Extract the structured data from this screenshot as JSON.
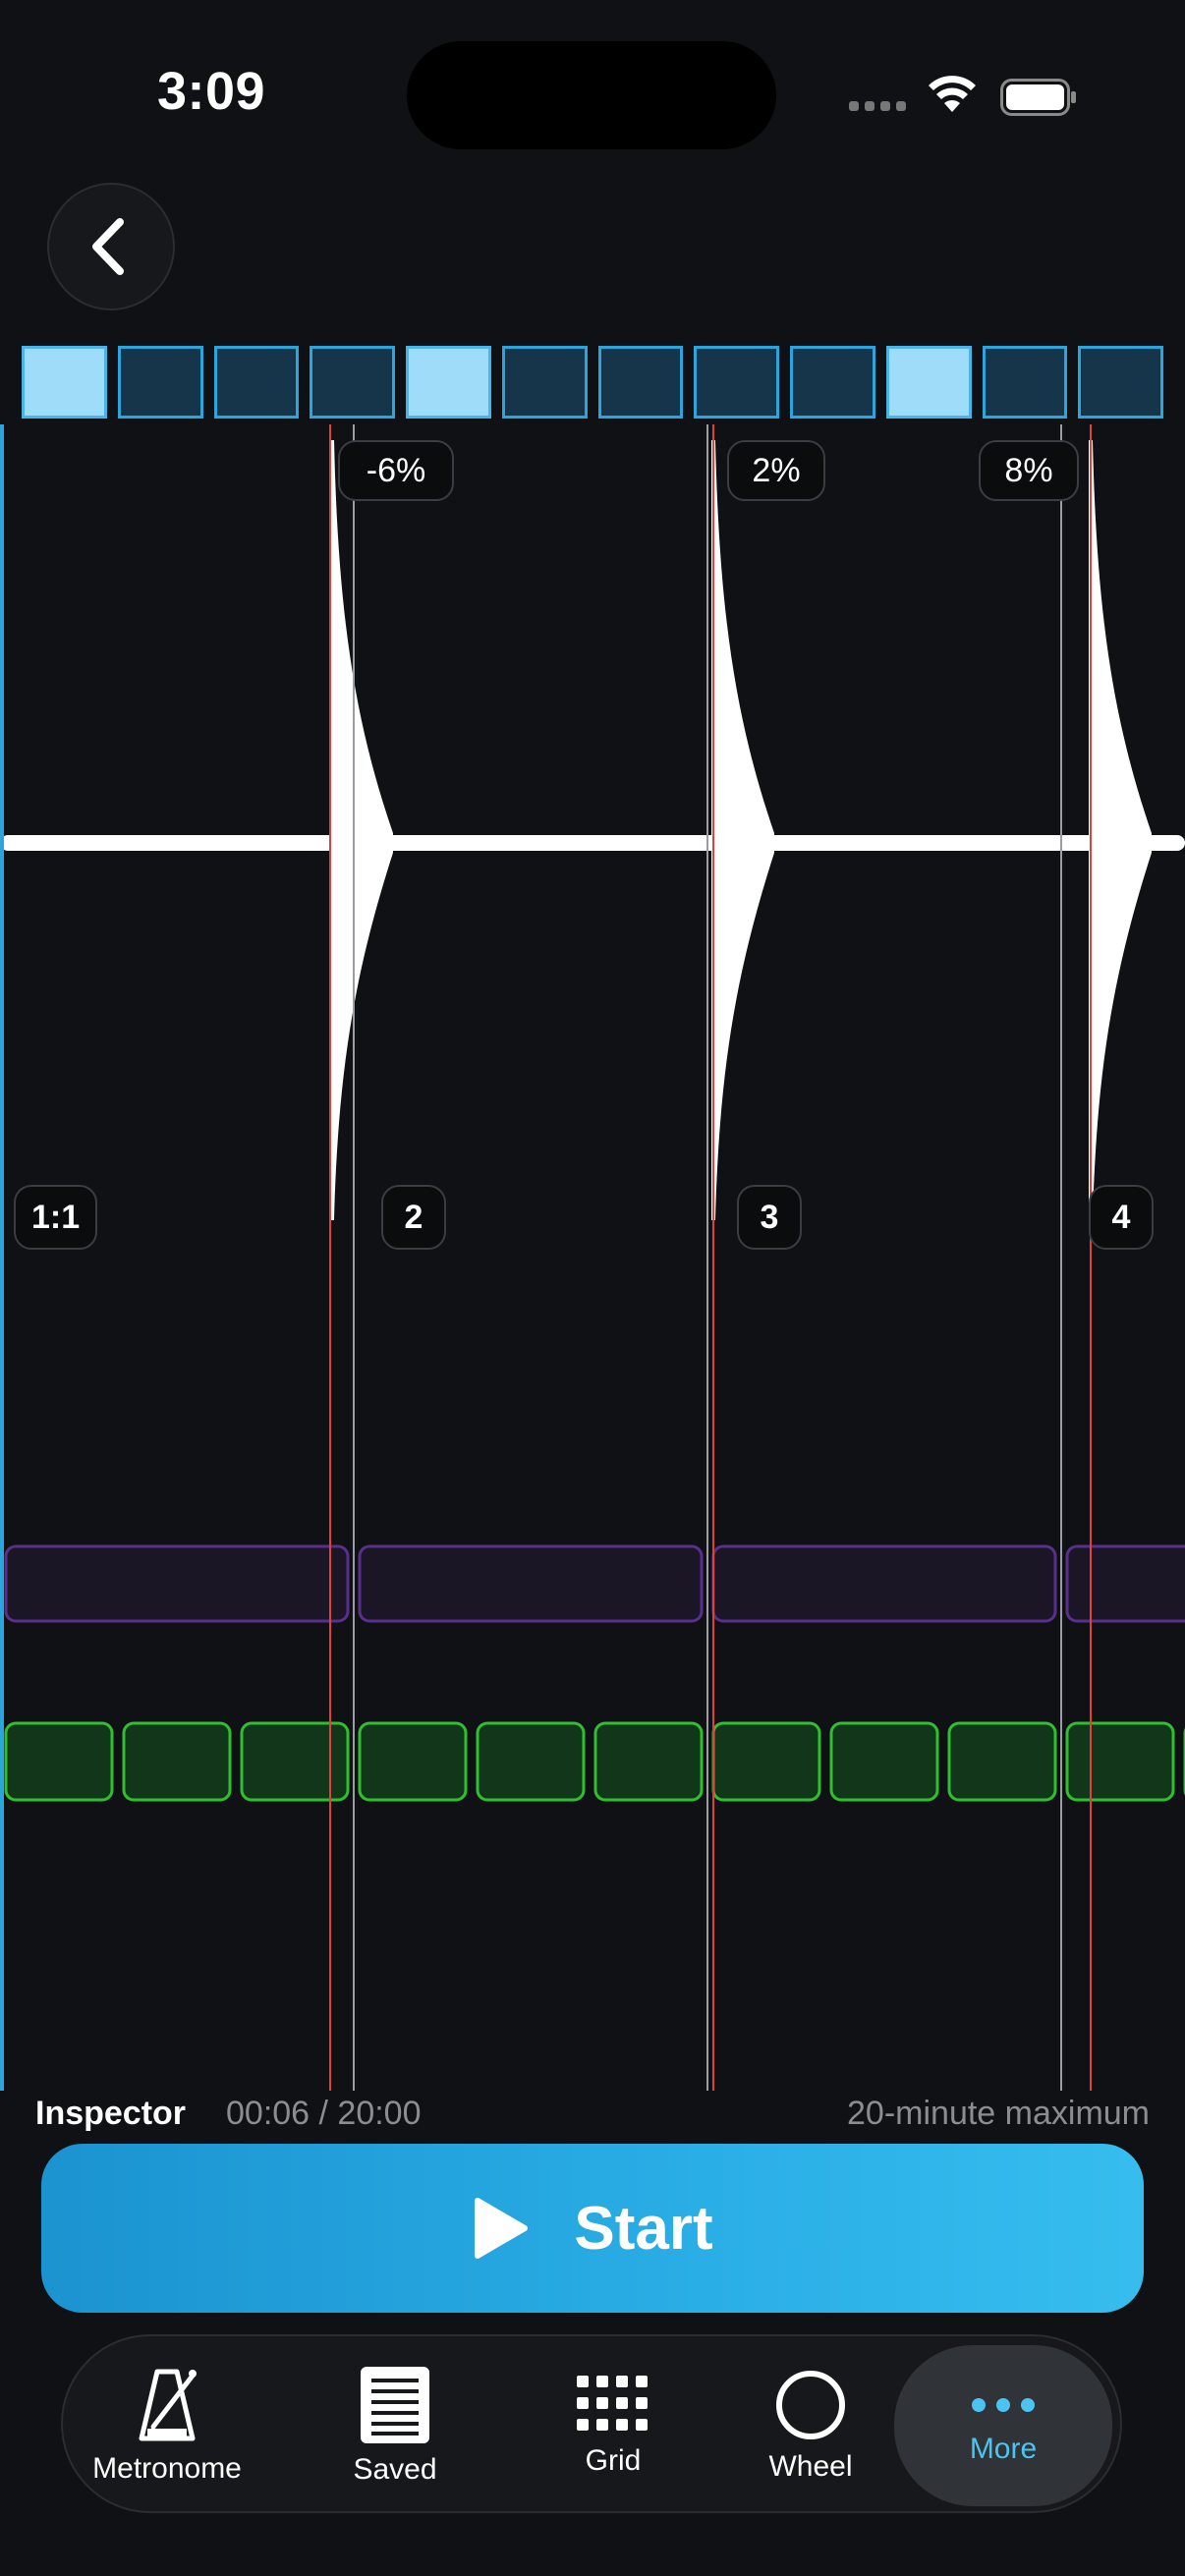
{
  "status_bar": {
    "time": "3:09"
  },
  "beats": [
    true,
    false,
    false,
    false,
    true,
    false,
    false,
    false,
    false,
    true,
    false,
    false
  ],
  "timeline": {
    "percent_labels": [
      "-6%",
      "2%",
      "8%"
    ],
    "beat_labels": [
      "1:1",
      "2",
      "3",
      "4"
    ]
  },
  "inspector": {
    "title": "Inspector",
    "time": "00:06 / 20:00",
    "limit": "20-minute maximum"
  },
  "start_button": {
    "label": "Start"
  },
  "tabs": [
    {
      "label": "Metronome",
      "icon": "metronome-icon"
    },
    {
      "label": "Saved",
      "icon": "saved-icon"
    },
    {
      "label": "Grid",
      "icon": "grid-icon"
    },
    {
      "label": "Wheel",
      "icon": "wheel-icon"
    },
    {
      "label": "More",
      "icon": "more-icon",
      "active": true
    }
  ],
  "colors": {
    "accent": "#2aa6dd",
    "active_tab": "#4cc4f2",
    "onset_marker": "#e0413a",
    "purple_track": "#5a2e8c",
    "green_track": "#2fbf2f"
  }
}
